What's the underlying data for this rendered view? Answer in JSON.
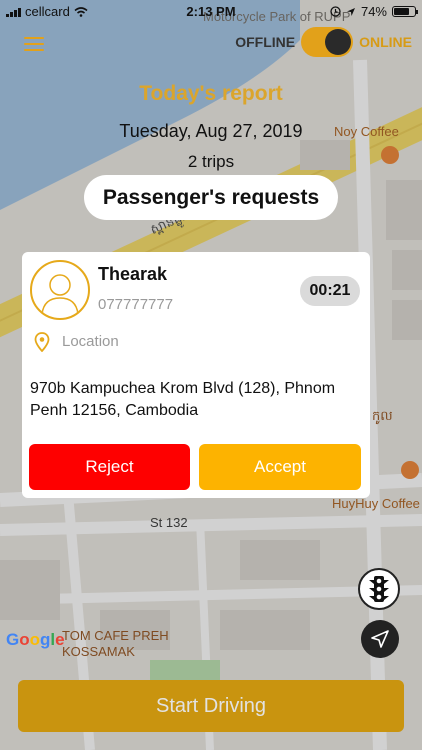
{
  "status_bar": {
    "carrier": "cellcard",
    "time": "2:13 PM",
    "battery": "74%",
    "battery_level": 0.74
  },
  "header": {
    "menu_icon": "hamburger-icon",
    "offline_label": "OFFLINE",
    "online_label": "ONLINE",
    "online": true
  },
  "report": {
    "title": "Today's report",
    "date": "Tuesday, Aug 27, 2019",
    "trips": "2 trips"
  },
  "requests_title": "Passenger's requests",
  "request": {
    "name": "Thearak",
    "phone": "077777777",
    "timer": "00:21",
    "location_label": "Location",
    "address": "970b Kampuchea Krom Blvd (128), Phnom Penh 12156, Cambodia",
    "reject_label": "Reject",
    "accept_label": "Accept"
  },
  "map": {
    "labels": {
      "park": "Motorcycle Park of RUPP",
      "noy": "Noy Coffee",
      "huyhuy": "HuyHuy Coffee",
      "street": "St 132",
      "tom_cafe": "TOM CAFE PREH\nKOSSAMAK",
      "khmer_road": "ស្ពានផ្លូវ",
      "khmer_right": "កូល"
    },
    "attribution": "Google"
  },
  "start_driving_label": "Start Driving",
  "colors": {
    "accent": "#e2a11a",
    "reject": "#fe0000",
    "accept": "#fdb300",
    "start": "#c9940f"
  }
}
